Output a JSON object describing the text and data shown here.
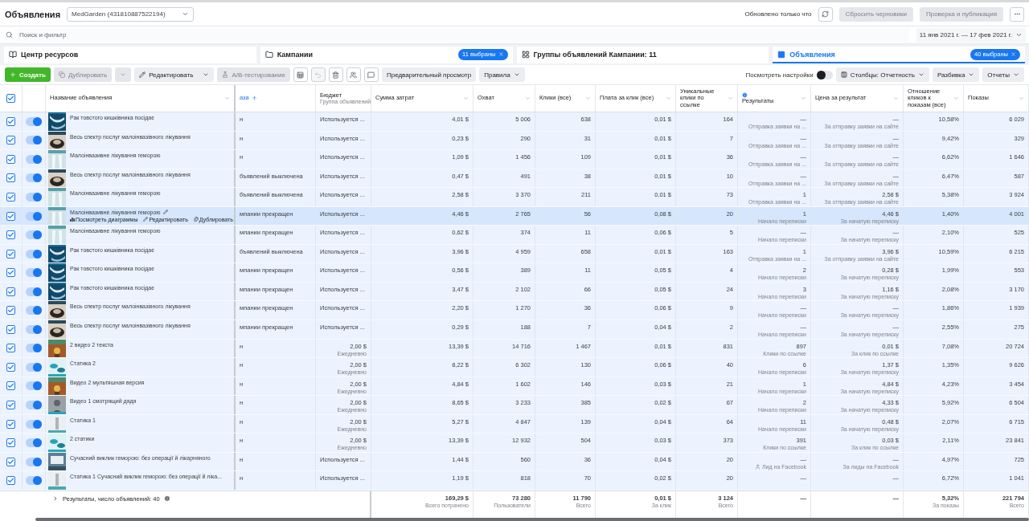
{
  "header": {
    "title": "Объявления",
    "account": "MedGarden (431810887522194)",
    "updated": "Обновлено только что",
    "actions": [
      {
        "label": "Сбросить черновики",
        "disabled": true
      },
      {
        "label": "Проверка и публикация",
        "disabled": true
      }
    ]
  },
  "search": {
    "placeholder": "Поиск и фильтр",
    "date_range": "11 янв 2021 г. — 17 фев 2021 г."
  },
  "tabs": [
    {
      "label": "Центр ресурсов",
      "selected": false
    },
    {
      "label": "Кампании",
      "selected": false,
      "badge": "11 выбраны"
    },
    {
      "label": "Группы объявлений Кампании: 11",
      "selected": false
    },
    {
      "label": "Объявления",
      "selected": true,
      "badge": "40 выбраны"
    }
  ],
  "toolbar": {
    "buttons": [
      {
        "label": "Создать",
        "kind": "primary",
        "disabled": false
      },
      {
        "label": "Дублировать",
        "kind": "split",
        "disabled": true
      },
      {
        "label": "Редактировать",
        "kind": "menu",
        "disabled": false
      },
      {
        "label": "A/B-тестирование",
        "kind": "plain",
        "disabled": true
      }
    ],
    "icon_buttons": [
      {
        "disabled": false
      },
      {
        "disabled": true
      },
      {
        "disabled": false
      },
      {
        "disabled": false
      },
      {
        "disabled": false
      }
    ],
    "preview": "Предварительный просмотр",
    "rules": "Правила",
    "view_settings": {
      "label": "Посмотреть настройки",
      "on": false
    },
    "menus": [
      "Столбцы: Отчетность",
      "Разбивка",
      "Отчеты"
    ]
  },
  "table": {
    "select_all": {
      "checked": true
    },
    "columns": [
      {
        "label": "Название объявления"
      },
      {
        "label": "аза",
        "sorted": true
      },
      {
        "label": "Бюджет",
        "sub": "Группа объявлений"
      },
      {
        "label": "Сумма затрат"
      },
      {
        "label": "Охват"
      },
      {
        "label": "Клики (все)"
      },
      {
        "label": "Плата за клик (все)"
      },
      {
        "label": "Уникальные клики по ссылке"
      },
      {
        "label": "Результаты",
        "info": true
      },
      {
        "label": "Цена за результат"
      },
      {
        "label": "Отношение кликов к показам (все)"
      },
      {
        "label": "Показы"
      }
    ],
    "rows": [
      {
        "name": "Рак товстого кишківника посідає",
        "delivery": "н",
        "budget": "Используется ...",
        "spend": "4,01 $",
        "reach": "5 006",
        "clicks": "638",
        "cpc": "0,01 $",
        "unique": "164",
        "result": "—",
        "result_sub": "Отправка заявки на ...",
        "cost": "—",
        "cost_sub": "За отправку заявки на сайте",
        "ctr": "10,58%",
        "impressions": "6 029",
        "checked": true,
        "on": true,
        "selected": false
      },
      {
        "name": "Весь спектр послуг малоінвазівного лікування",
        "delivery": "н",
        "budget": "Используется ...",
        "spend": "0,23 $",
        "reach": "290",
        "clicks": "31",
        "cpc": "0,01 $",
        "unique": "7",
        "result": "—",
        "result_sub": "Отправка заявки на ...",
        "cost": "—",
        "cost_sub": "За отправку заявки на сайте",
        "ctr": "9,42%",
        "impressions": "329",
        "checked": true,
        "on": true,
        "selected": false
      },
      {
        "name": "Малоінвазивне лікування геморою",
        "delivery": "н",
        "budget": "Используется ...",
        "spend": "1,09 $",
        "reach": "1 456",
        "clicks": "109",
        "cpc": "0,01 $",
        "unique": "36",
        "result": "—",
        "result_sub": "Отправка заявки на ...",
        "cost": "—",
        "cost_sub": "За отправку заявки на сайте",
        "ctr": "6,62%",
        "impressions": "1 646",
        "checked": true,
        "on": true,
        "selected": false
      },
      {
        "name": "Весь спектр послуг малоінвазівного лікування",
        "delivery": "бъявлений выключена",
        "budget": "Используется ...",
        "spend": "0,47 $",
        "reach": "491",
        "clicks": "38",
        "cpc": "0,01 $",
        "unique": "10",
        "result": "—",
        "result_sub": "Отправка заявки на ...",
        "cost": "—",
        "cost_sub": "За отправку заявки на сайте",
        "ctr": "6,47%",
        "impressions": "587",
        "checked": true,
        "on": true,
        "selected": false
      },
      {
        "name": "Малоінвазивне лікування геморою",
        "delivery": "бъявлений выключена",
        "budget": "Используется ...",
        "spend": "2,58 $",
        "reach": "3 370",
        "clicks": "211",
        "cpc": "0,01 $",
        "unique": "73",
        "result": "1",
        "result_sub": "Отправка заявки на ...",
        "cost": "2,58 $",
        "cost_sub": "За отправку заявки на сайте",
        "ctr": "5,38%",
        "impressions": "3 924",
        "checked": true,
        "on": true,
        "selected": false
      },
      {
        "name": "Малоінвазивне лікування геморою",
        "actions": [
          "Посмотреть диаграммы",
          "Редактировать",
          "Дублировать"
        ],
        "delivery": "мпании прекращен",
        "budget": "Используется ...",
        "spend": "4,46 $",
        "reach": "2 765",
        "clicks": "56",
        "cpc": "0,08 $",
        "unique": "20",
        "result": "1",
        "result_sub": "Начало переписки",
        "cost": "4,46 $",
        "cost_sub": "За начатую переписку",
        "ctr": "1,40%",
        "impressions": "4 001",
        "checked": true,
        "on": true,
        "selected": true
      },
      {
        "name": "Малоінвазивне лікування геморою",
        "delivery": "мпании прекращен",
        "budget": "Используется ...",
        "spend": "0,62 $",
        "reach": "374",
        "clicks": "11",
        "cpc": "0,06 $",
        "unique": "5",
        "result": "—",
        "result_sub": "Начало переписки",
        "cost": "—",
        "cost_sub": "За начатую переписку",
        "ctr": "2,10%",
        "impressions": "525",
        "checked": true,
        "on": true,
        "selected": false
      },
      {
        "name": "Рак товстого кишківника посідає",
        "delivery": "бъявлений выключена",
        "budget": "Используется ...",
        "spend": "3,96 $",
        "reach": "4 959",
        "clicks": "658",
        "cpc": "0,01 $",
        "unique": "163",
        "result": "1",
        "result_sub": "Отправка заявки на ...",
        "cost": "3,96 $",
        "cost_sub": "За отправку заявки на сайте",
        "ctr": "10,59%",
        "impressions": "6 215",
        "checked": true,
        "on": true,
        "selected": false
      },
      {
        "name": "Рак товстого кишківника посідає",
        "delivery": "мпании прекращен",
        "budget": "Используется ...",
        "spend": "0,56 $",
        "reach": "389",
        "clicks": "11",
        "cpc": "0,05 $",
        "unique": "4",
        "result": "2",
        "result_sub": "Начало переписки",
        "cost": "0,28 $",
        "cost_sub": "За начатую переписку",
        "ctr": "1,99%",
        "impressions": "553",
        "checked": true,
        "on": true,
        "selected": false
      },
      {
        "name": "Рак товстого кишківника посідає",
        "delivery": "мпании прекращен",
        "budget": "Используется ...",
        "spend": "3,47 $",
        "reach": "2 102",
        "clicks": "66",
        "cpc": "0,05 $",
        "unique": "24",
        "result": "3",
        "result_sub": "Начало переписки",
        "cost": "1,16 $",
        "cost_sub": "За начатую переписку",
        "ctr": "2,08%",
        "impressions": "3 170",
        "checked": true,
        "on": true,
        "selected": false
      },
      {
        "name": "Весь спектр послуг малоінвазівного лікування",
        "delivery": "мпании прекращен",
        "budget": "Используется ...",
        "spend": "2,20 $",
        "reach": "1 270",
        "clicks": "36",
        "cpc": "0,06 $",
        "unique": "9",
        "result": "—",
        "result_sub": "Начало переписки",
        "cost": "—",
        "cost_sub": "За начатую переписку",
        "ctr": "1,86%",
        "impressions": "1 939",
        "checked": true,
        "on": true,
        "selected": false
      },
      {
        "name": "Весь спектр послуг малоінвазівного лікування",
        "delivery": "мпании прекращен",
        "budget": "Используется ...",
        "spend": "0,29 $",
        "reach": "188",
        "clicks": "7",
        "cpc": "0,04 $",
        "unique": "2",
        "result": "—",
        "result_sub": "Начало переписки",
        "cost": "—",
        "cost_sub": "За начатую переписку",
        "ctr": "2,55%",
        "impressions": "275",
        "checked": true,
        "on": true,
        "selected": false
      },
      {
        "name": "2 видео 2 текста",
        "delivery": "н",
        "budget": "2,00 $",
        "budget_sub": "Ежедневно",
        "spend": "13,39 $",
        "reach": "14 716",
        "clicks": "1 467",
        "cpc": "0,01 $",
        "unique": "831",
        "result": "897",
        "result_sub": "Клики по ссылке",
        "cost": "0,01 $",
        "cost_sub": "За клик по ссылке",
        "ctr": "7,08%",
        "impressions": "20 724",
        "checked": true,
        "on": true,
        "selected": false
      },
      {
        "name": "Статика 2",
        "delivery": "н",
        "budget": "2,00 $",
        "budget_sub": "Ежедневно",
        "spend": "8,22 $",
        "reach": "6 302",
        "clicks": "130",
        "cpc": "0,06 $",
        "unique": "40",
        "result": "6",
        "result_sub": "Начало переписки",
        "cost": "1,37 $",
        "cost_sub": "За начатую переписку",
        "ctr": "1,35%",
        "impressions": "9 626",
        "checked": true,
        "on": true,
        "selected": false
      },
      {
        "name": "Видео 2 мультяшная версия",
        "delivery": "н",
        "budget": "2,00 $",
        "budget_sub": "Ежедневно",
        "spend": "4,84 $",
        "reach": "1 602",
        "clicks": "146",
        "cpc": "0,03 $",
        "unique": "21",
        "result": "1",
        "result_sub": "Начало переписки",
        "cost": "4,84 $",
        "cost_sub": "За начатую переписку",
        "ctr": "4,23%",
        "impressions": "3 454",
        "checked": true,
        "on": true,
        "selected": false
      },
      {
        "name": "Видео 1 смотрящий дядя",
        "delivery": "н",
        "budget": "2,00 $",
        "budget_sub": "Ежедневно",
        "spend": "8,65 $",
        "reach": "3 233",
        "clicks": "385",
        "cpc": "0,02 $",
        "unique": "67",
        "result": "2",
        "result_sub": "Начало переписки",
        "cost": "4,33 $",
        "cost_sub": "За начатую переписку",
        "ctr": "5,92%",
        "impressions": "6 504",
        "checked": true,
        "on": true,
        "selected": false
      },
      {
        "name": "Статика 1",
        "delivery": "н",
        "budget": "2,00 $",
        "budget_sub": "Ежедневно",
        "spend": "5,27 $",
        "reach": "4 847",
        "clicks": "139",
        "cpc": "0,04 $",
        "unique": "64",
        "result": "11",
        "result_sub": "Начало переписки",
        "cost": "0,48 $",
        "cost_sub": "За начатую переписку",
        "ctr": "2,07%",
        "impressions": "6 715",
        "checked": true,
        "on": true,
        "selected": false
      },
      {
        "name": "2 статики",
        "delivery": "н",
        "budget": "2,00 $",
        "budget_sub": "Ежедневно",
        "spend": "13,39 $",
        "reach": "12 932",
        "clicks": "504",
        "cpc": "0,03 $",
        "unique": "373",
        "result": "391",
        "result_sub": "Клики по ссылке",
        "cost": "0,03 $",
        "cost_sub": "За клик по ссылке",
        "ctr": "2,11%",
        "impressions": "23 841",
        "checked": true,
        "on": true,
        "selected": false
      },
      {
        "name": "Сучасний виклик геморою: без операції й лікарняного",
        "delivery": "н",
        "budget": "Используется ...",
        "spend": "1,44 $",
        "reach": "560",
        "clicks": "36",
        "cpc": "0,04 $",
        "unique": "20",
        "result": "—",
        "result_sub": "Лид на Facebook",
        "result_icon": true,
        "cost": "—",
        "cost_sub": "За лиды на Facebook",
        "ctr": "4,97%",
        "impressions": "725",
        "checked": true,
        "on": true,
        "selected": false
      },
      {
        "name": "Статика 1 Сучасний виклик геморою: без операції й ліка...",
        "delivery": "н",
        "budget": "Используется ...",
        "spend": "1,19 $",
        "reach": "818",
        "clicks": "70",
        "cpc": "0,02 $",
        "unique": "20",
        "result": "—",
        "cost": "—",
        "ctr": "6,72%",
        "impressions": "1 041",
        "checked": true,
        "on": true,
        "selected": false
      }
    ],
    "footer": {
      "label": "Результаты, число объявлений: 40",
      "totals": [
        {
          "value": "169,29 $",
          "sub": "Всего потрачено"
        },
        {
          "value": "73 280",
          "sub": "Пользователи"
        },
        {
          "value": "11 790",
          "sub": "Всего"
        },
        {
          "value": "0,01 $",
          "sub": "За клик"
        },
        {
          "value": "3 124",
          "sub": "Всего"
        },
        {
          "value": "—"
        },
        {
          "value": "—"
        },
        {
          "value": "5,32%",
          "sub": "За показы"
        },
        {
          "value": "221 794",
          "sub": "Всего"
        }
      ]
    }
  }
}
